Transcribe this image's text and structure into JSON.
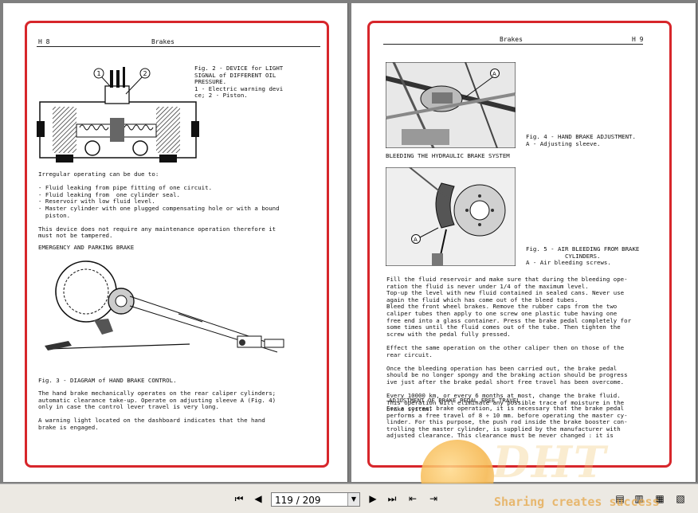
{
  "left_page": {
    "header_left": "H 8",
    "header_center": "Brakes",
    "fig2_caption": "Fig. 2 - DEVICE for LIGHT\nSIGNAL of DIFFERENT OIL\nPRESSURE.\n1 - Electric warning devi\nce; 2 - Piston.",
    "fig2_labels": [
      "1",
      "2"
    ],
    "irregular_text": "Irregular operating can be due to:\n\n- Fluid leaking from pipe fitting of one circuit.\n- Fluid leaking from  one cylinder seal.\n- Reservoir with low fluid level.\n- Master cylinder with one plugged compensating hole or with a bound\n  piston.\n\nThis device does not require any maintenance operation therefore it\nmust not be tampered.",
    "section_emergency": "EMERGENCY AND PARKING BRAKE",
    "fig3_caption": "Fig. 3 - DIAGRAM of HAND BRAKE CONTROL.",
    "hand_brake_text": "The hand brake mechanically operates on the rear caliper cylinders;\nautomatic clearance take-up. Operate on adjusting sleeve A (Fig. 4)\nonly in case the control lever travel is very long.\n\nA warning light located on the dashboard indicates that the hand\nbrake is engaged."
  },
  "right_page": {
    "header_center": "Brakes",
    "header_right": "H 9",
    "fig4_caption": "Fig. 4 - HAND BRAKE ADJUSTMENT.\nA - Adjusting sleeve.",
    "fig4_label": "A",
    "section_bleeding": "BLEEDING THE HYDRAULIC BRAKE SYSTEM",
    "fig5_caption": "Fig. 5 - AIR BLEEDING FROM BRAKE\n           CYLINDERS.\nA - Air bleeding screws.",
    "fig5_label": "A",
    "bleeding_text": "Fill the fluid reservoir and make sure that during the bleeding ope-\nration the fluid is never under 1/4 of the maximum level.\nTop-up the level with new fluid contained in sealed cans. Never use\nagain the fluid which has come out of the bleed tubes.\nBleed the front wheel brakes. Remove the rubber caps from the two\ncaliper tubes then apply to one screw one plastic tube having one\nfree end into a glass container. Press the brake pedal completely for\nsome times until the fluid comes out of the tube. Then tighten the\nscrew with the pedal fully pressed.\n\nEffect the same operation on the other caliper then on those of the\nrear circuit.\n\nOnce the bleeding operation has been carried out, the brake pedal\nshould be no longer spongy and the braking action should be progress\nive just after the brake pedal short free travel has been overcome.\n\nEvery 10000 km, or every 6 months at most, change the brake fluid.\nThis operation will eliminate any possible trace of moisture in the\nbrake system.",
    "section_adjustment": "ADJUSTMENT OF BRAKE PEDAL FREE TRAVEL",
    "adjustment_text": "For a correct brake operation, it is necessary that the brake pedal\nperforms a free travel of 8 ÷ 10 mm. before operating the master cy-\nlinder. For this purpose, the push rod inside the brake booster con-\ntrolling the master cylinder, is supplied by the manufacturer with\nadjusted clearance. This clearance must be never changed : it is"
  },
  "toolbar": {
    "page_indicator": "119 / 209",
    "icons": [
      "first-page-icon",
      "prev-page-icon",
      "dropdown-icon",
      "next-page-icon",
      "last-page-icon",
      "back-view-icon",
      "forward-view-icon",
      "single-page-icon",
      "two-page-icon",
      "continuous-icon",
      "two-page-continuous-icon"
    ]
  },
  "watermark": {
    "logo_text": "DHT",
    "slogan": "Sharing creates success"
  },
  "colors": {
    "frame": "#d7262b",
    "viewer_bg": "#7f7f7f",
    "toolbar_bg": "#ece9e3"
  }
}
